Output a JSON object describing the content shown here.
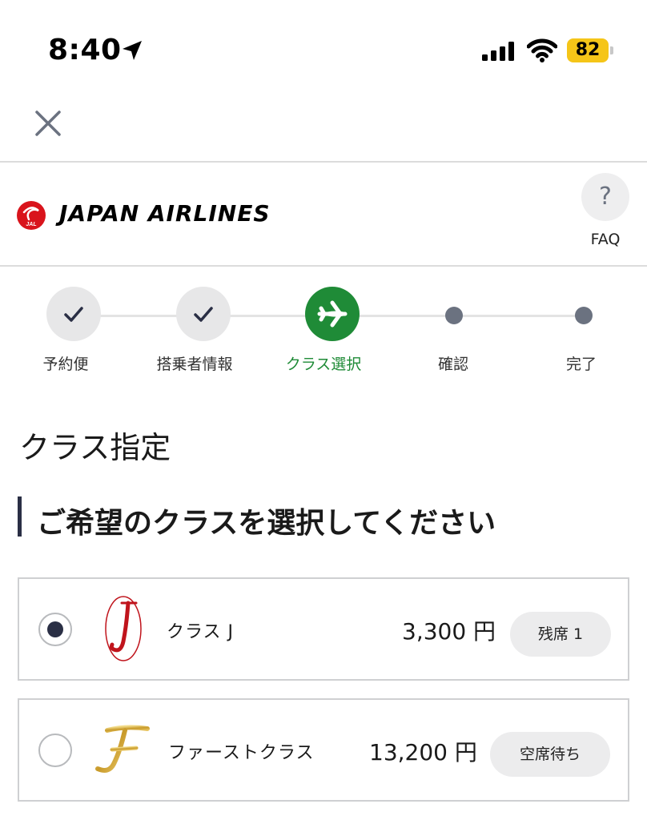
{
  "status_bar": {
    "time": "8:40",
    "battery": "82",
    "icons": [
      "location-arrow-icon",
      "cellular-signal-icon",
      "wifi-icon",
      "battery-icon"
    ]
  },
  "nav": {
    "close_icon": "close-icon"
  },
  "header": {
    "airline_name": "JAPAN AIRLINES",
    "logo_text": "JAL",
    "faq_symbol": "?",
    "faq_label": "FAQ",
    "brand_color": "#d9141c"
  },
  "stepper": {
    "active_color": "#1f8b37",
    "steps": [
      {
        "label": "予約便",
        "state": "done"
      },
      {
        "label": "搭乗者情報",
        "state": "done"
      },
      {
        "label": "クラス選択",
        "state": "active"
      },
      {
        "label": "確認",
        "state": "pending"
      },
      {
        "label": "完了",
        "state": "pending"
      }
    ]
  },
  "page_title": "クラス指定",
  "section_heading": "ご希望のクラスを選択してください",
  "options": [
    {
      "logo": "class-j-logo",
      "name": "クラス J",
      "price": "3,300 円",
      "availability": "残席 1",
      "selected": true
    },
    {
      "logo": "first-class-logo",
      "name": "ファーストクラス",
      "price": "13,200 円",
      "availability": "空席待ち",
      "selected": false
    }
  ]
}
